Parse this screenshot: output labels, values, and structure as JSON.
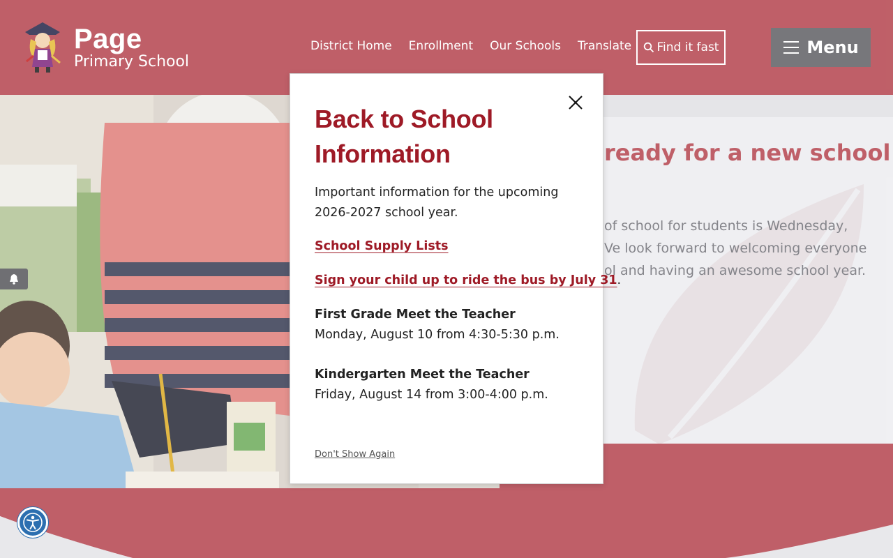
{
  "header": {
    "brand_name": "Page",
    "brand_sub": "Primary School",
    "nav": [
      "District Home",
      "Enrollment",
      "Our Schools",
      "Translate"
    ],
    "find_label": "Find it fast",
    "menu_label": "Menu"
  },
  "hero": {
    "title": "ready for a new school",
    "text_lines": [
      "of school for students is Wednesday,",
      "Ve look forward to welcoming everyone",
      "ol and having an awesome school year."
    ]
  },
  "modal": {
    "title": "Back to School Information",
    "intro": "Important information for the upcoming 2026-2027 school year.",
    "supply_link": "School Supply Lists",
    "bus_link": "Sign your child up to ride the bus by July 31",
    "bus_suffix": ".",
    "events": [
      {
        "title": "First Grade Meet the Teacher",
        "when": "Monday, August 10 from 4:30-5:30 p.m."
      },
      {
        "title": "Kindergarten Meet the Teacher",
        "when": "Friday, August 14 from 3:00-4:00 p.m."
      }
    ],
    "dont_show": "Don't Show Again"
  },
  "colors": {
    "brand": "#bb565f",
    "modal_accent": "#9e1a26",
    "menu_bg": "#6f6f73",
    "a11y": "#2c6fb0"
  },
  "icons": [
    "logo-mascot-icon",
    "search-icon",
    "hamburger-icon",
    "close-icon",
    "bell-icon",
    "accessibility-icon",
    "leaf-watermark-icon"
  ]
}
